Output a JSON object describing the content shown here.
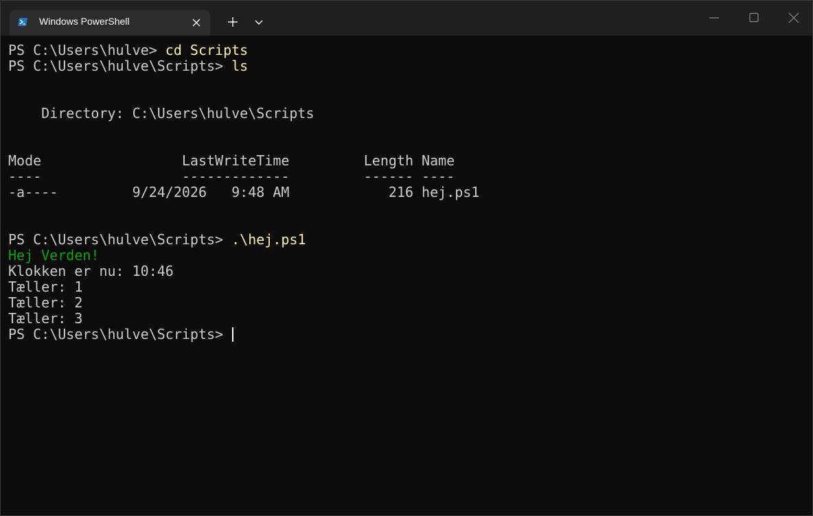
{
  "window": {
    "tab_title": "Windows PowerShell",
    "icon": "powershell-icon",
    "buttons": [
      "new-tab-icon",
      "chevron-down-icon",
      "minimize-icon",
      "maximize-icon",
      "close-icon"
    ]
  },
  "colors": {
    "background": "#0c0c0c",
    "titlebar": "#202020",
    "tab": "#2c2c2c",
    "text": "#cccccc",
    "command": "#f9f1a5",
    "success": "#13a10e",
    "powershell_blue": "#2671be"
  },
  "terminal": {
    "line1": {
      "prompt": "PS C:\\Users\\hulve> ",
      "command": "cd Scripts"
    },
    "line2": {
      "prompt": "PS C:\\Users\\hulve\\Scripts> ",
      "command": "ls"
    },
    "directory": "    Directory: C:\\Users\\hulve\\Scripts",
    "table": {
      "header": "Mode                 LastWriteTime         Length Name",
      "underline": "----                 -------------         ------ ----",
      "rows": [
        "-a----         9/24/2026   9:48 AM            216 hej.ps1"
      ]
    },
    "line3": {
      "prompt": "PS C:\\Users\\hulve\\Scripts> ",
      "command": ".\\hej.ps1"
    },
    "output": {
      "greeting": "Hej Verden!",
      "lines": [
        "Klokken er nu: 10:46",
        "Tæller: 1",
        "Tæller: 2",
        "Tæller: 3"
      ]
    },
    "final_prompt": "PS C:\\Users\\hulve\\Scripts> "
  }
}
